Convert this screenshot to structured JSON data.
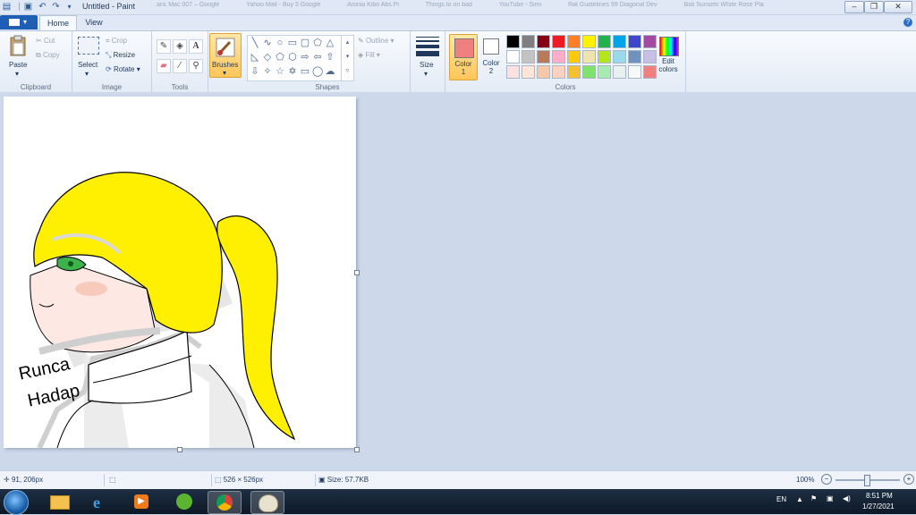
{
  "window": {
    "title": "Untitled - Paint"
  },
  "background_tabs": [
    "aric Mac 007 – Google",
    "Yahoo Mail - Buy 5 Google",
    "Aronia Kibo Abs Pi",
    "Things to on bad",
    "YouTube - Simi",
    "Rat Guidelines 99 Diagonal Dev",
    "Bali Sunsets White Rose Pla"
  ],
  "tabs": {
    "file": "",
    "home": "Home",
    "view": "View"
  },
  "clipboard": {
    "paste": "Paste",
    "cut": "Cut",
    "copy": "Copy",
    "label": "Clipboard"
  },
  "image": {
    "select": "Select",
    "crop": "Crop",
    "resize": "Resize",
    "rotate": "Rotate",
    "label": "Image"
  },
  "tools": {
    "label": "Tools"
  },
  "brushes": {
    "label": "Brushes"
  },
  "shapes": {
    "outline": "Outline",
    "fill": "Fill",
    "label": "Shapes"
  },
  "size": {
    "label": "Size"
  },
  "colors": {
    "color1_label": "Color\n1",
    "color2_label": "Color\n2",
    "color1": "#f08080",
    "color2": "#ffffff",
    "edit_label": "Edit\ncolors",
    "label": "Colors",
    "palette_row1": [
      "#000000",
      "#7f7f7f",
      "#880015",
      "#ed1c24",
      "#ff7f27",
      "#fff200",
      "#22b14c",
      "#00a2e8",
      "#3f48cc",
      "#a349a4"
    ],
    "palette_row2": [
      "#ffffff",
      "#c3c3c3",
      "#b97a57",
      "#ffaec9",
      "#ffc90e",
      "#efe4b0",
      "#b5e61d",
      "#99d9ea",
      "#7092be",
      "#c8bfe7"
    ],
    "palette_row3": [
      "#fde1e1",
      "#fde5d8",
      "#f7c8a8",
      "#fbd3c0",
      "#f7c030",
      "#80e070",
      "#a8ecb0",
      "#e9f0f0",
      "#f8fafa",
      "#f08080",
      "#dfe6f0"
    ]
  },
  "canvas_art": {
    "signature_line1": "Runca",
    "signature_line2": "Hadap",
    "watermark": "Run"
  },
  "status": {
    "cursor_pos": "91, 206px",
    "canvas_size": "526 × 526px",
    "file_size": "Size: 57.7KB",
    "zoom": "100%"
  },
  "tray": {
    "lang": "EN",
    "time": "8:51 PM",
    "date": "1/27/2021"
  }
}
